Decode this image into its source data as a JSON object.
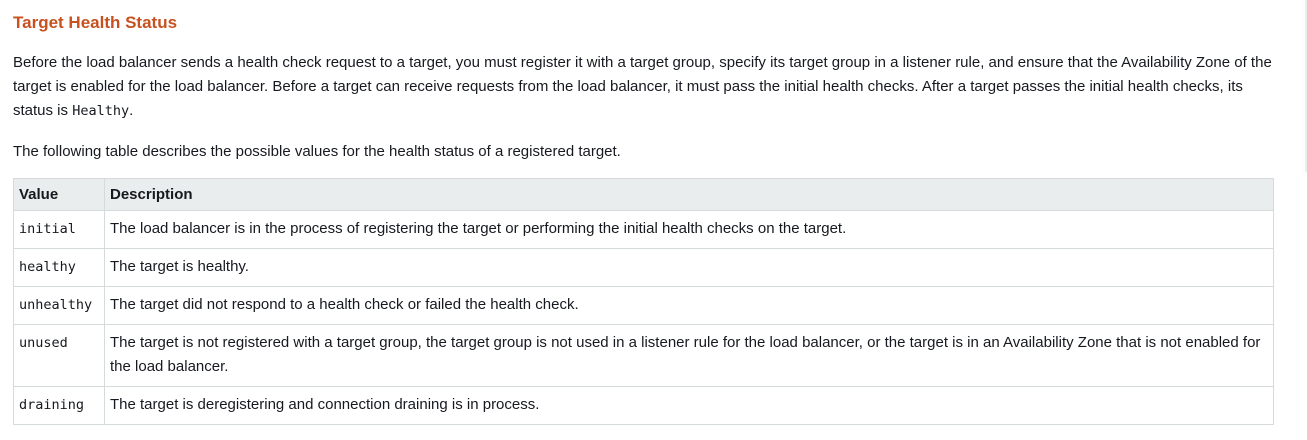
{
  "heading": "Target Health Status",
  "intro": {
    "text_before_code": "Before the load balancer sends a health check request to a target, you must register it with a target group, specify its target group in a listener rule, and ensure that the Availability Zone of the target is enabled for the load balancer. Before a target can receive requests from the load balancer, it must pass the initial health checks. After a target passes the initial health checks, its status is ",
    "code": "Healthy",
    "text_after_code": "."
  },
  "table_intro": "The following table describes the possible values for the health status of a registered target.",
  "table": {
    "headers": [
      "Value",
      "Description"
    ],
    "rows": [
      {
        "value": "initial",
        "description": "The load balancer is in the process of registering the target or performing the initial health checks on the target."
      },
      {
        "value": "healthy",
        "description": "The target is healthy."
      },
      {
        "value": "unhealthy",
        "description": "The target did not respond to a health check or failed the health check."
      },
      {
        "value": "unused",
        "description": "The target is not registered with a target group, the target group is not used in a listener rule for the load balancer, or the target is in an Availability Zone that is not enabled for the load balancer."
      },
      {
        "value": "draining",
        "description": "The target is deregistering and connection draining is in process."
      }
    ]
  },
  "colors": {
    "heading": "#c7511f",
    "text": "#16191f",
    "table_header_bg": "#eaeded",
    "border": "#d5dbdb"
  }
}
